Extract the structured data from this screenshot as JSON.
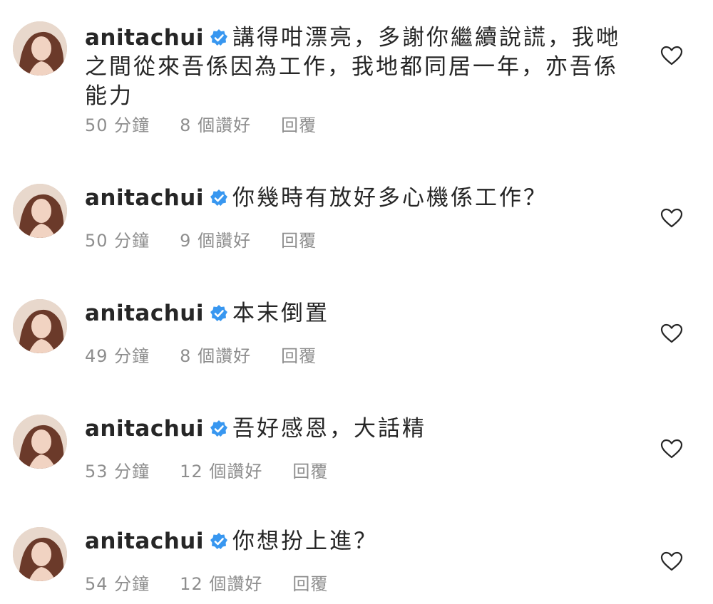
{
  "comments": [
    {
      "username": "anitachui",
      "text": "講得咁漂亮，多謝你繼續說謊，我哋之間從來吾係因為工作，我地都同居一年，亦吾係能力",
      "time": "50 分鐘",
      "likes": "8 個讚好",
      "reply": "回覆"
    },
    {
      "username": "anitachui",
      "text": "你幾時有放好多心機係工作？",
      "time": "50 分鐘",
      "likes": "9 個讚好",
      "reply": "回覆"
    },
    {
      "username": "anitachui",
      "text": "本末倒置",
      "time": "49 分鐘",
      "likes": "8 個讚好",
      "reply": "回覆"
    },
    {
      "username": "anitachui",
      "text": "吾好感恩，大話精",
      "time": "53 分鐘",
      "likes": "12 個讚好",
      "reply": "回覆"
    },
    {
      "username": "anitachui",
      "text": "你想扮上進？",
      "time": "54 分鐘",
      "likes": "12 個讚好",
      "reply": "回覆"
    }
  ],
  "icons": {
    "verified": "verified-badge-icon",
    "like": "heart-outline-icon"
  },
  "colors": {
    "verified_blue": "#3897f0",
    "meta_gray": "#8e8e8e",
    "text": "#262626"
  }
}
